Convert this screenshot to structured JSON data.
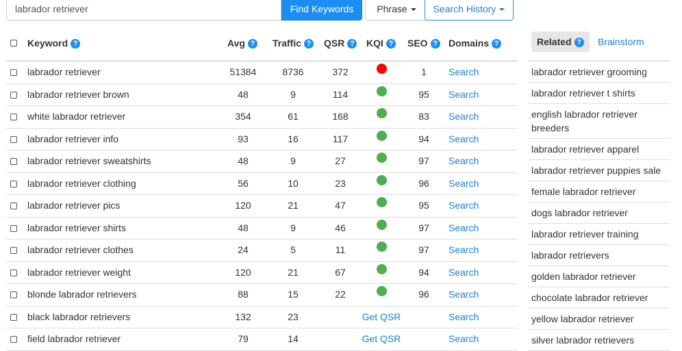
{
  "search": {
    "query": "labrador retriever",
    "find_label": "Find Keywords",
    "match_label": "Phrase",
    "history_label": "Search History"
  },
  "colors": {
    "accent": "#1c8ef2",
    "kqi_red": "#ff0000",
    "kqi_green": "#4caf50"
  },
  "table": {
    "headers": {
      "keyword": "Keyword",
      "avg": "Avg",
      "traffic": "Traffic",
      "qsr": "QSR",
      "kqi": "KQI",
      "seo": "SEO",
      "domains": "Domains"
    },
    "help_glyph": "?",
    "rows": [
      {
        "keyword": "labrador retriever",
        "avg": "51384",
        "traffic": "8736",
        "qsr": "372",
        "kqi": "red",
        "seo": "1",
        "domains": "Search"
      },
      {
        "keyword": "labrador retriever brown",
        "avg": "48",
        "traffic": "9",
        "qsr": "114",
        "kqi": "green",
        "seo": "95",
        "domains": "Search"
      },
      {
        "keyword": "white labrador retriever",
        "avg": "354",
        "traffic": "61",
        "qsr": "168",
        "kqi": "green",
        "seo": "83",
        "domains": "Search"
      },
      {
        "keyword": "labrador retriever info",
        "avg": "93",
        "traffic": "16",
        "qsr": "117",
        "kqi": "green",
        "seo": "94",
        "domains": "Search"
      },
      {
        "keyword": "labrador retriever sweatshirts",
        "avg": "48",
        "traffic": "9",
        "qsr": "27",
        "kqi": "green",
        "seo": "97",
        "domains": "Search"
      },
      {
        "keyword": "labrador retriever clothing",
        "avg": "56",
        "traffic": "10",
        "qsr": "23",
        "kqi": "green",
        "seo": "96",
        "domains": "Search"
      },
      {
        "keyword": "labrador retriever pics",
        "avg": "120",
        "traffic": "21",
        "qsr": "47",
        "kqi": "green",
        "seo": "95",
        "domains": "Search"
      },
      {
        "keyword": "labrador retriever shirts",
        "avg": "48",
        "traffic": "9",
        "qsr": "46",
        "kqi": "green",
        "seo": "97",
        "domains": "Search"
      },
      {
        "keyword": "labrador retriever clothes",
        "avg": "24",
        "traffic": "5",
        "qsr": "11",
        "kqi": "green",
        "seo": "97",
        "domains": "Search"
      },
      {
        "keyword": "labrador retriever weight",
        "avg": "120",
        "traffic": "21",
        "qsr": "67",
        "kqi": "green",
        "seo": "94",
        "domains": "Search"
      },
      {
        "keyword": "blonde labrador retrievers",
        "avg": "88",
        "traffic": "15",
        "qsr": "22",
        "kqi": "green",
        "seo": "96",
        "domains": "Search"
      },
      {
        "keyword": "black labrador retrievers",
        "avg": "132",
        "traffic": "23",
        "qsr": "",
        "kqi": "Get QSR",
        "seo": "",
        "domains": "Search"
      },
      {
        "keyword": "field labrador retriever",
        "avg": "79",
        "traffic": "14",
        "qsr": "",
        "kqi": "Get QSR",
        "seo": "",
        "domains": "Search"
      }
    ]
  },
  "related": {
    "tab_related": "Related",
    "tab_brainstorm": "Brainstorm",
    "items": [
      "labrador retriever grooming",
      "labrador retriever t shirts",
      "english labrador retriever breeders",
      "labrador retriever apparel",
      "labrador retriever puppies sale",
      "female labrador retriever",
      "dogs labrador retriever",
      "labrador retriever training",
      "labrador retrievers",
      "golden labrador retriever",
      "chocolate labrador retriever",
      "yellow labrador retriever",
      "silver labrador retrievers"
    ]
  }
}
